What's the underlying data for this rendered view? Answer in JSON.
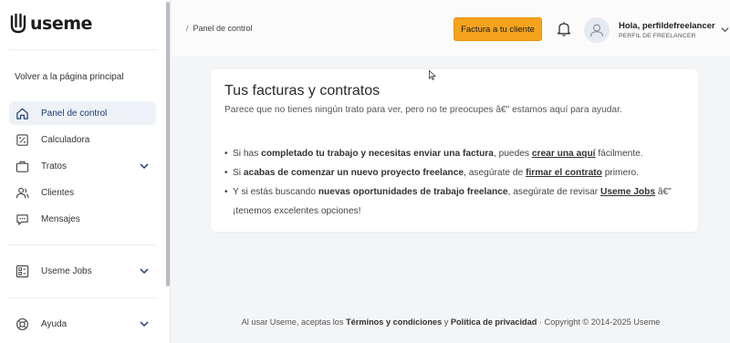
{
  "brand": {
    "name": "useme"
  },
  "sidebar": {
    "back_label": "Volver a la página principal",
    "items": [
      {
        "label": "Panel de control",
        "icon": "home-icon",
        "active": true
      },
      {
        "label": "Calculadora",
        "icon": "calculator-icon"
      },
      {
        "label": "Tratos",
        "icon": "briefcase-icon",
        "expandable": true
      },
      {
        "label": "Clientes",
        "icon": "users-icon"
      },
      {
        "label": "Mensajes",
        "icon": "chat-icon"
      },
      {
        "label": "Useme Jobs",
        "icon": "jobs-icon",
        "expandable": true
      },
      {
        "label": "Ayuda",
        "icon": "lifebuoy-icon",
        "expandable": true
      }
    ]
  },
  "header": {
    "breadcrumb_sep": "/",
    "breadcrumb": "Panel de control",
    "cta_label": "Factura a tu cliente",
    "user_greeting": "Hola, perfildefreelancer",
    "user_role": "PERFIL DE FREELANCER"
  },
  "card": {
    "title": "Tus facturas y contratos",
    "subtitle": "Parece que no tienes ningún trato para ver, pero no te preocupes â€\" estamos aquí para ayudar.",
    "bullet1": {
      "a": "Si has ",
      "b": "completado tu trabajo y necesitas enviar una factura",
      "c": ", puedes ",
      "link": "crear una aquí",
      "d": " fácilmente."
    },
    "bullet2": {
      "a": "Si ",
      "b": "acabas de comenzar un nuevo proyecto freelance",
      "c": ", asegúrate de ",
      "link": "firmar el contrato",
      "d": " primero."
    },
    "bullet3": {
      "a": "Y si estás buscando ",
      "b": "nuevas oportunidades de trabajo freelance",
      "c": ", asegúrate de revisar ",
      "link": "Useme Jobs",
      "d": " â€\" ¡tenemos excelentes opciones!"
    }
  },
  "footer": {
    "a": "Al usar Useme, aceptas los ",
    "terms": "Términos y condiciones",
    "b": " y ",
    "privacy": "Política de privacidad",
    "c": " · Copyright © 2014-2025 Useme"
  },
  "colors": {
    "accent": "#f5a31c",
    "active_bg": "#eef2f8",
    "nav_active": "#1f3c6e"
  }
}
